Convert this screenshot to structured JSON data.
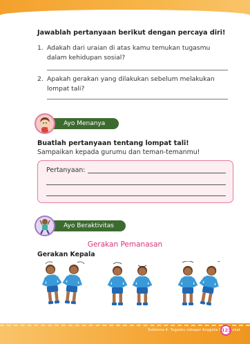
{
  "questions": {
    "title": "Jawablah pertanyaan berikut dengan percaya diri!",
    "items": [
      {
        "num": "1.",
        "text": "Adakah dari uraian di atas kamu temukan tugasmu dalam kehidupan sosial?"
      },
      {
        "num": "2.",
        "text": "Apakah gerakan yang dilakukan sebelum melakukan lompat tali?"
      }
    ]
  },
  "ayo_menanya": {
    "label": "Ayo Menanya",
    "instruction_title": "Buatlah pertanyaan tentang lompat tali!",
    "instruction_sub": "Sampaikan kepada gurumu dan teman-temanmu!",
    "box_label": "Pertanyaan:"
  },
  "ayo_beraktivitas": {
    "label": "Ayo Beraktivitas",
    "section_title": "Gerakan Pemanasan",
    "subsection": "Gerakan Kepala"
  },
  "footer": {
    "book_title": "Subtema 4: Tugasku sebagai Anggota Masyarakat",
    "page_number": "123"
  },
  "colors": {
    "band_orange": "#f4a12c",
    "pill_green": "#3c6b2f",
    "accent_pink": "#e47c9e",
    "title_magenta": "#d8337a",
    "figure_blue": "#3a9ad9"
  }
}
